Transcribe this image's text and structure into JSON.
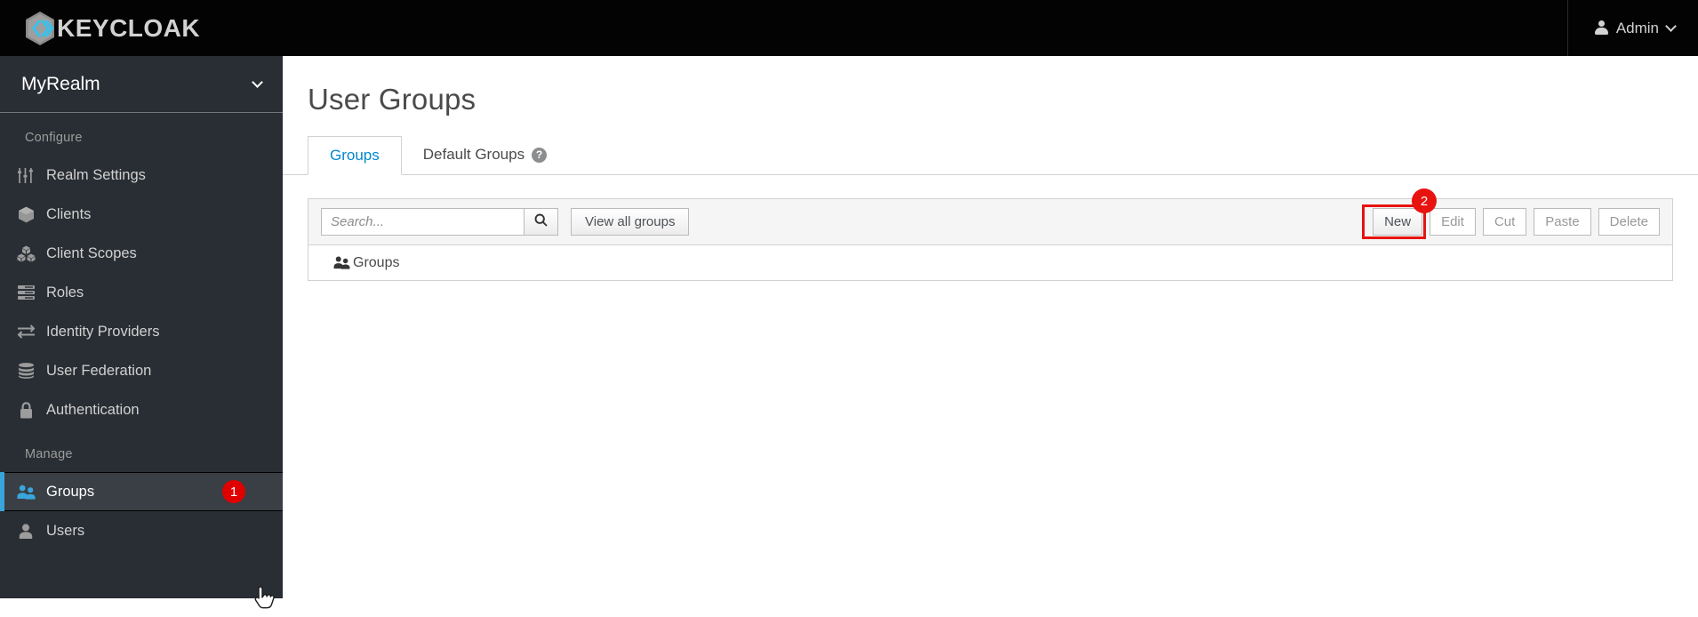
{
  "masthead": {
    "brand_text": "KEYCLOAK",
    "brand_logo_icon": "keycloak-hexagon-logo",
    "admin_label": "Admin",
    "admin_icon": "user-icon",
    "admin_chevron_icon": "chevron-down-icon"
  },
  "sidebar": {
    "realm": {
      "name": "MyRealm",
      "chevron_icon": "chevron-down-icon"
    },
    "groups": [
      {
        "title": "Configure",
        "items": [
          {
            "label": "Realm Settings",
            "icon": "sliders-icon",
            "active": false
          },
          {
            "label": "Clients",
            "icon": "cube-icon",
            "active": false
          },
          {
            "label": "Client Scopes",
            "icon": "cubes-icon",
            "active": false
          },
          {
            "label": "Roles",
            "icon": "list-bars-icon",
            "active": false
          },
          {
            "label": "Identity Providers",
            "icon": "exchange-arrows-icon",
            "active": false
          },
          {
            "label": "User Federation",
            "icon": "database-icon",
            "active": false
          },
          {
            "label": "Authentication",
            "icon": "lock-icon",
            "active": false
          }
        ]
      },
      {
        "title": "Manage",
        "items": [
          {
            "label": "Groups",
            "icon": "users-icon",
            "active": true,
            "badge": "1"
          },
          {
            "label": "Users",
            "icon": "user-icon",
            "active": false
          }
        ]
      }
    ],
    "cursor_icon": "hand-pointer-cursor"
  },
  "main": {
    "page_title": "User Groups",
    "tabs": [
      {
        "label": "Groups",
        "active": true
      },
      {
        "label": "Default Groups",
        "active": false,
        "help_icon": "question-circle-icon",
        "help_glyph": "?"
      }
    ],
    "toolbar": {
      "search_placeholder": "Search...",
      "search_value": "",
      "search_icon": "search-icon",
      "view_all_label": "View all groups",
      "actions": [
        {
          "label": "New",
          "disabled": false,
          "highlighted": true,
          "step": "2"
        },
        {
          "label": "Edit",
          "disabled": true
        },
        {
          "label": "Cut",
          "disabled": true
        },
        {
          "label": "Paste",
          "disabled": true
        },
        {
          "label": "Delete",
          "disabled": true
        }
      ]
    },
    "table": {
      "rows": [
        {
          "label": "Groups",
          "icon": "users-icon"
        }
      ]
    }
  },
  "colors": {
    "masthead_bg": "#030303",
    "sidebar_bg": "#292e34",
    "sidebar_active_bg": "#393f44",
    "accent_blue": "#0088ce",
    "active_marker": "#39a5dc",
    "badge_red": "#e8120e",
    "toolbar_bg": "#f5f5f5",
    "border_grey": "#d1d1d1"
  }
}
